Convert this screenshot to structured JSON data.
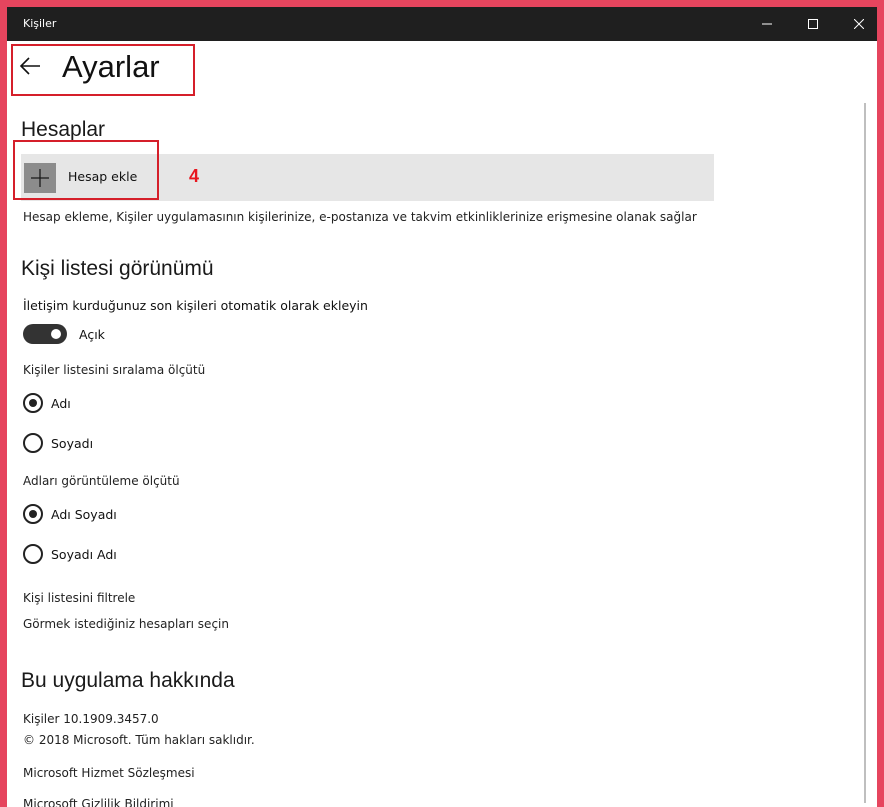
{
  "window": {
    "title": "Kişiler"
  },
  "header": {
    "title": "Ayarlar"
  },
  "accounts": {
    "heading": "Hesaplar",
    "add_label": "Hesap ekle",
    "annotation": "4",
    "description": "Hesap ekleme, Kişiler uygulamasının kişilerinize, e-postanıza ve takvim etkinliklerinize erişmesine olanak sağlar"
  },
  "contact_list": {
    "heading": "Kişi listesi görünümü",
    "auto_add_label": "İletişim kurduğunuz son kişileri otomatik olarak ekleyin",
    "toggle_state": "Açık",
    "toggle_on": true,
    "sort_label": "Kişiler listesini sıralama ölçütü",
    "sort_options": [
      {
        "label": "Adı",
        "selected": true
      },
      {
        "label": "Soyadı",
        "selected": false
      }
    ],
    "display_label": "Adları görüntüleme ölçütü",
    "display_options": [
      {
        "label": "Adı Soyadı",
        "selected": true
      },
      {
        "label": "Soyadı Adı",
        "selected": false
      }
    ],
    "filter_heading": "Kişi listesini filtrele",
    "filter_link": "Görmek istediğiniz hesapları seçin"
  },
  "about": {
    "heading": "Bu uygulama hakkında",
    "version": "Kişiler 10.1909.3457.0",
    "copyright": "© 2018 Microsoft. Tüm hakları saklıdır.",
    "service_agreement": "Microsoft Hizmet Sözleşmesi",
    "privacy": "Microsoft Gizlilik Bildirimi"
  },
  "colors": {
    "background_frame": "#e6455e",
    "titlebar": "#1f1f1f",
    "highlight": "#d51f2a",
    "annotation": "#e8161f"
  },
  "icons": [
    "back-arrow-icon",
    "minimize-icon",
    "maximize-icon",
    "close-icon",
    "plus-icon"
  ]
}
